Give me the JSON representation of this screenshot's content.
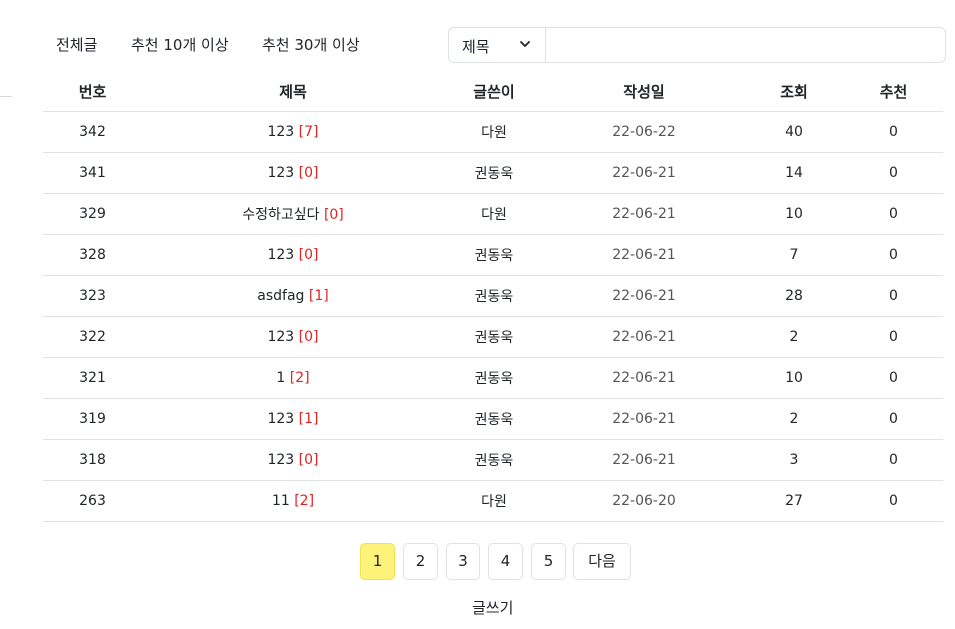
{
  "filters": [
    {
      "label": "전체글"
    },
    {
      "label": "추천 10개 이상"
    },
    {
      "label": "추천 30개 이상"
    }
  ],
  "search": {
    "field_selected": "제목",
    "query": "",
    "placeholder": ""
  },
  "table": {
    "headers": {
      "no": "번호",
      "title": "제목",
      "author": "글쓴이",
      "date": "작성일",
      "views": "조회",
      "likes": "추천"
    },
    "rows": [
      {
        "no": "342",
        "title": "123",
        "comments": "[7]",
        "author": "다원",
        "date": "22-06-22",
        "views": "40",
        "likes": "0"
      },
      {
        "no": "341",
        "title": "123",
        "comments": "[0]",
        "author": "권동욱",
        "date": "22-06-21",
        "views": "14",
        "likes": "0"
      },
      {
        "no": "329",
        "title": "수정하고싶다",
        "comments": "[0]",
        "author": "다원",
        "date": "22-06-21",
        "views": "10",
        "likes": "0"
      },
      {
        "no": "328",
        "title": "123",
        "comments": "[0]",
        "author": "권동욱",
        "date": "22-06-21",
        "views": "7",
        "likes": "0"
      },
      {
        "no": "323",
        "title": "asdfag",
        "comments": "[1]",
        "author": "권동욱",
        "date": "22-06-21",
        "views": "28",
        "likes": "0"
      },
      {
        "no": "322",
        "title": "123",
        "comments": "[0]",
        "author": "권동욱",
        "date": "22-06-21",
        "views": "2",
        "likes": "0"
      },
      {
        "no": "321",
        "title": "1",
        "comments": "[2]",
        "author": "권동욱",
        "date": "22-06-21",
        "views": "10",
        "likes": "0"
      },
      {
        "no": "319",
        "title": "123",
        "comments": "[1]",
        "author": "권동욱",
        "date": "22-06-21",
        "views": "2",
        "likes": "0"
      },
      {
        "no": "318",
        "title": "123",
        "comments": "[0]",
        "author": "권동욱",
        "date": "22-06-21",
        "views": "3",
        "likes": "0"
      },
      {
        "no": "263",
        "title": "11",
        "comments": "[2]",
        "author": "다원",
        "date": "22-06-20",
        "views": "27",
        "likes": "0"
      }
    ]
  },
  "pagination": {
    "pages": [
      "1",
      "2",
      "3",
      "4",
      "5"
    ],
    "current": "1",
    "next_label": "다음"
  },
  "write_label": "글쓰기",
  "colors": {
    "active_page": "#fff27a",
    "comment_count": "#e02424",
    "border": "#dee2e6"
  },
  "icons": {
    "select_toggle": "chevron-down-icon"
  }
}
